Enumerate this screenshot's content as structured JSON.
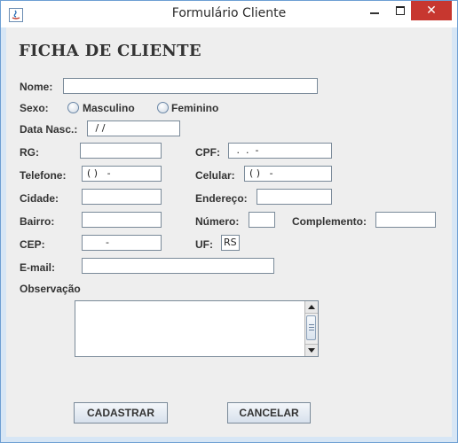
{
  "window": {
    "title": "Formulário Cliente",
    "close_glyph": "✕"
  },
  "form": {
    "heading": "FICHA DE CLIENTE",
    "nome": {
      "label": "Nome:",
      "value": ""
    },
    "sexo": {
      "label": "Sexo:",
      "options": [
        "Masculino",
        "Feminino"
      ],
      "selected": null
    },
    "data_nasc": {
      "label": "Data Nasc.:",
      "value": " / /"
    },
    "rg": {
      "label": "RG:",
      "value": ""
    },
    "cpf": {
      "label": "CPF:",
      "value": " .  .  -"
    },
    "telefone": {
      "label": "Telefone:",
      "value": "( )   -"
    },
    "celular": {
      "label": "Celular:",
      "value": "( )   -"
    },
    "cidade": {
      "label": "Cidade:",
      "value": ""
    },
    "endereco": {
      "label": "Endereço:",
      "value": ""
    },
    "bairro": {
      "label": "Bairro:",
      "value": ""
    },
    "numero": {
      "label": "Número:",
      "value": ""
    },
    "complemento": {
      "label": "Complemento:",
      "value": ""
    },
    "cep": {
      "label": "CEP:",
      "value": "      -"
    },
    "uf": {
      "label": "UF:",
      "value": "RS"
    },
    "email": {
      "label": "E-mail:",
      "value": ""
    },
    "observacao": {
      "label": "Observação",
      "value": ""
    },
    "buttons": {
      "cadastrar": "CADASTRAR",
      "cancelar": "CANCELAR"
    }
  },
  "icons": {
    "app": "java-app-icon",
    "minimize": "minimize-icon",
    "maximize": "maximize-icon",
    "close": "close-icon"
  }
}
